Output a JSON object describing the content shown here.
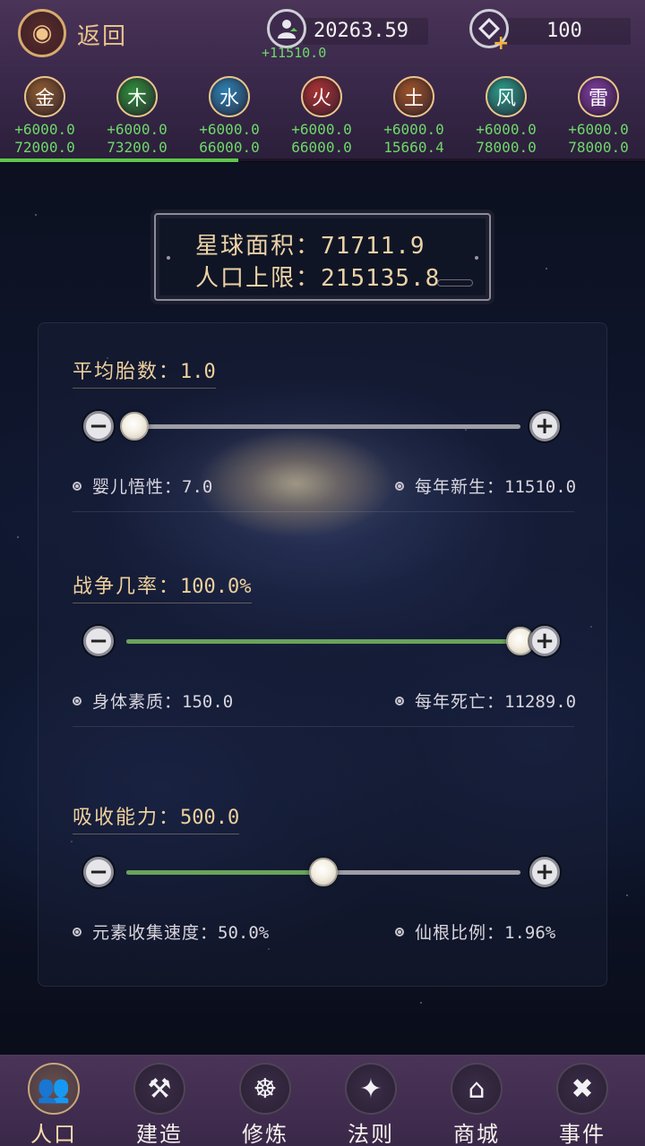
{
  "header": {
    "back_label": "返回",
    "back_glyph": "◉",
    "population_value": "20263.59",
    "population_delta": "+11510.0",
    "coin_value": "100"
  },
  "elements": [
    {
      "char": "金",
      "rate": "+6000.0",
      "total": "72000.0",
      "color": "#8a5a2e"
    },
    {
      "char": "木",
      "rate": "+6000.0",
      "total": "73200.0",
      "color": "#2f8a3a"
    },
    {
      "char": "水",
      "rate": "+6000.0",
      "total": "66000.0",
      "color": "#2d7fb0"
    },
    {
      "char": "火",
      "rate": "+6000.0",
      "total": "66000.0",
      "color": "#a83232"
    },
    {
      "char": "土",
      "rate": "+6000.0",
      "total": "15660.4",
      "color": "#9a5228"
    },
    {
      "char": "风",
      "rate": "+6000.0",
      "total": "78000.0",
      "color": "#2a9a8a"
    },
    {
      "char": "雷",
      "rate": "+6000.0",
      "total": "78000.0",
      "color": "#7a3a9a"
    }
  ],
  "element_progress": 0.37,
  "planet": {
    "area_label": "星球面积：",
    "area_value": "71711.9",
    "pop_cap_label": "人口上限：",
    "pop_cap_value": "215135.8"
  },
  "sections": [
    {
      "title_label": "平均胎数：",
      "title_value": "1.0",
      "level": 0.02,
      "left_stat_label": "婴儿悟性：",
      "left_stat_value": "7.0",
      "right_stat_label": "每年新生：",
      "right_stat_value": "11510.0"
    },
    {
      "title_label": "战争几率：",
      "title_value": "100.0%",
      "level": 1.0,
      "left_stat_label": "身体素质：",
      "left_stat_value": "150.0",
      "right_stat_label": "每年死亡：",
      "right_stat_value": "11289.0"
    },
    {
      "title_label": "吸收能力：",
      "title_value": "500.0",
      "level": 0.5,
      "left_stat_label": "元素收集速度：",
      "left_stat_value": "50.0%",
      "right_stat_label": "仙根比例：",
      "right_stat_value": "1.96%"
    }
  ],
  "slider_minus": "−",
  "slider_plus": "+",
  "nav": [
    {
      "label": "人口",
      "icon": "people-icon",
      "glyph": "👥",
      "active": true
    },
    {
      "label": "建造",
      "icon": "hammer-wrench-icon",
      "glyph": "⚒",
      "active": false
    },
    {
      "label": "修炼",
      "icon": "meditation-icon",
      "glyph": "☸",
      "active": false
    },
    {
      "label": "法则",
      "icon": "scroll-icon",
      "glyph": "✦",
      "active": false
    },
    {
      "label": "商城",
      "icon": "shop-icon",
      "glyph": "⌂",
      "active": false
    },
    {
      "label": "事件",
      "icon": "book-icon",
      "glyph": "✖",
      "active": false
    }
  ]
}
